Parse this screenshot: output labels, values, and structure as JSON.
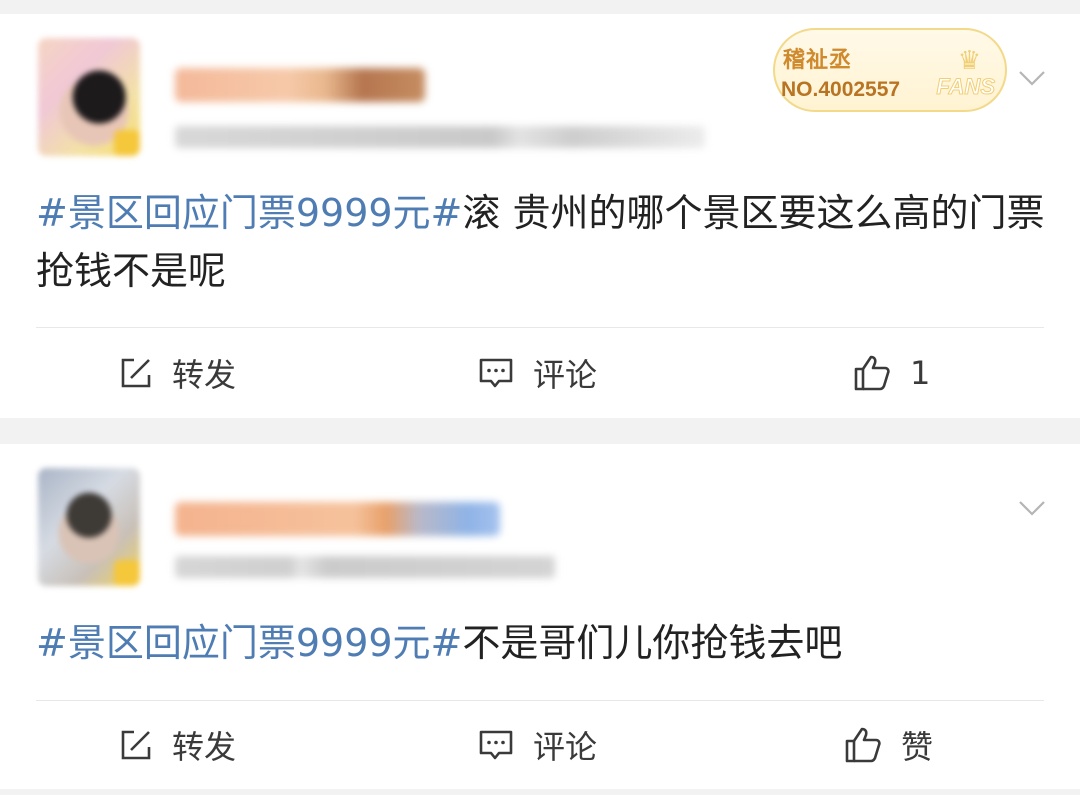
{
  "posts": [
    {
      "fans_badge": {
        "name": "稽祉丞",
        "number": "NO.4002557",
        "label": "FANS"
      },
      "text_topic": "#景区回应门票9999元#",
      "text_body": "滚 贵州的哪个景区要这么高的门票 抢钱不是呢",
      "actions": {
        "repost": "转发",
        "comment": "评论",
        "like": "1"
      }
    },
    {
      "text_topic": "#景区回应门票9999元#",
      "text_body": "不是哥们儿你抢钱去吧",
      "actions": {
        "repost": "转发",
        "comment": "评论",
        "like": "赞"
      }
    }
  ],
  "icons": {
    "repost": "share-edit-icon",
    "comment": "comment-bubble-icon",
    "like": "thumbs-up-icon",
    "more": "chevron-down-icon"
  },
  "colors": {
    "topic": "#4f7db3",
    "text": "#222222",
    "fans_gold": "#d08a2e"
  }
}
